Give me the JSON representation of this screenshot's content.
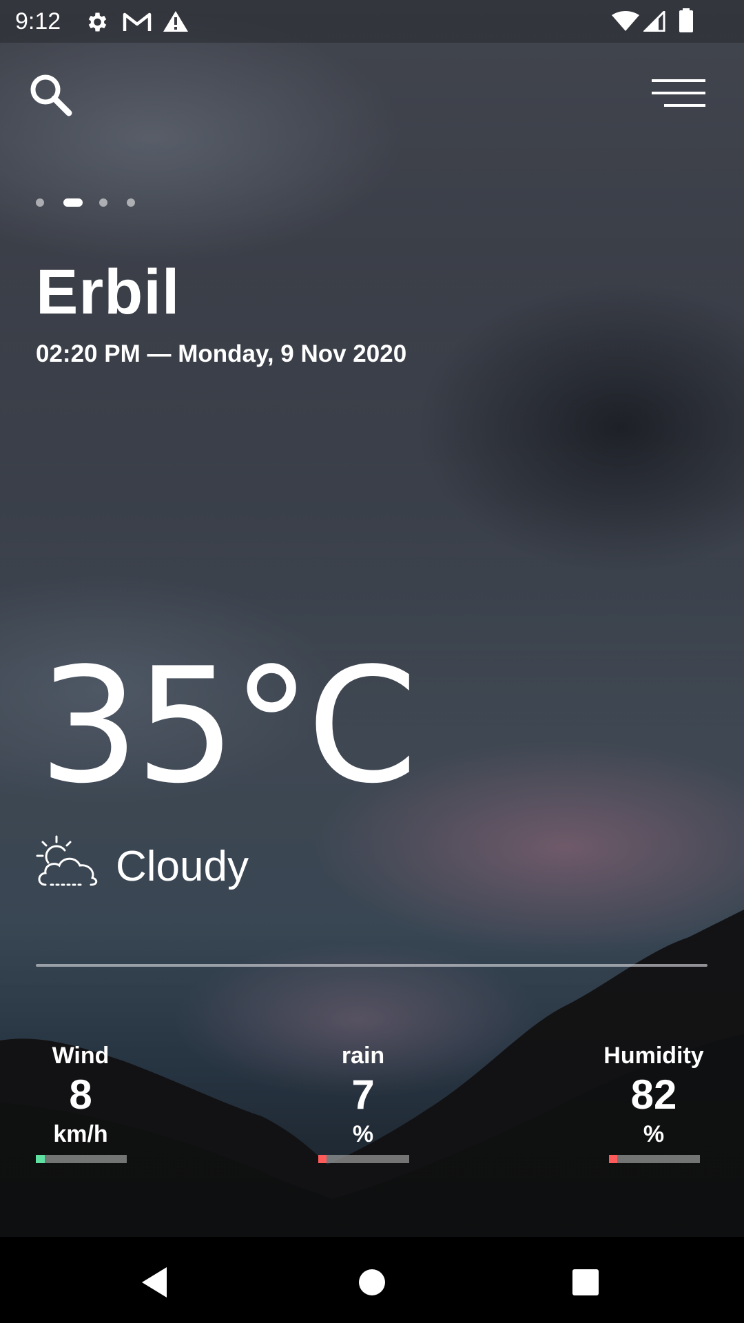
{
  "status_bar": {
    "time": "9:12",
    "icons": [
      "settings-icon",
      "gmail-icon",
      "warning-icon",
      "wifi-icon",
      "cell-signal-icon",
      "battery-icon"
    ]
  },
  "header": {
    "search_icon": "search-icon",
    "menu_icon": "menu-icon"
  },
  "pager": {
    "count": 4,
    "active_index": 1
  },
  "location": {
    "city": "Erbil",
    "datetime": "02:20 PM — Monday, 9 Nov 2020"
  },
  "weather": {
    "temperature": "35°C",
    "condition": "Cloudy",
    "condition_icon": "partly-cloudy-icon"
  },
  "stats": {
    "wind": {
      "label": "Wind",
      "value": "8",
      "unit": "km/h",
      "level": 0.1,
      "color": "#5ee0a0"
    },
    "rain": {
      "label": "rain",
      "value": "7",
      "unit": "%",
      "level": 0.07,
      "color": "#ff5a5a"
    },
    "humidity": {
      "label": "Humidity",
      "value": "82",
      "unit": "%",
      "level": 0.08,
      "color": "#ff5a5a"
    }
  },
  "nav_bar": {
    "back_icon": "back-icon",
    "home_icon": "home-icon",
    "recents_icon": "recents-icon"
  }
}
